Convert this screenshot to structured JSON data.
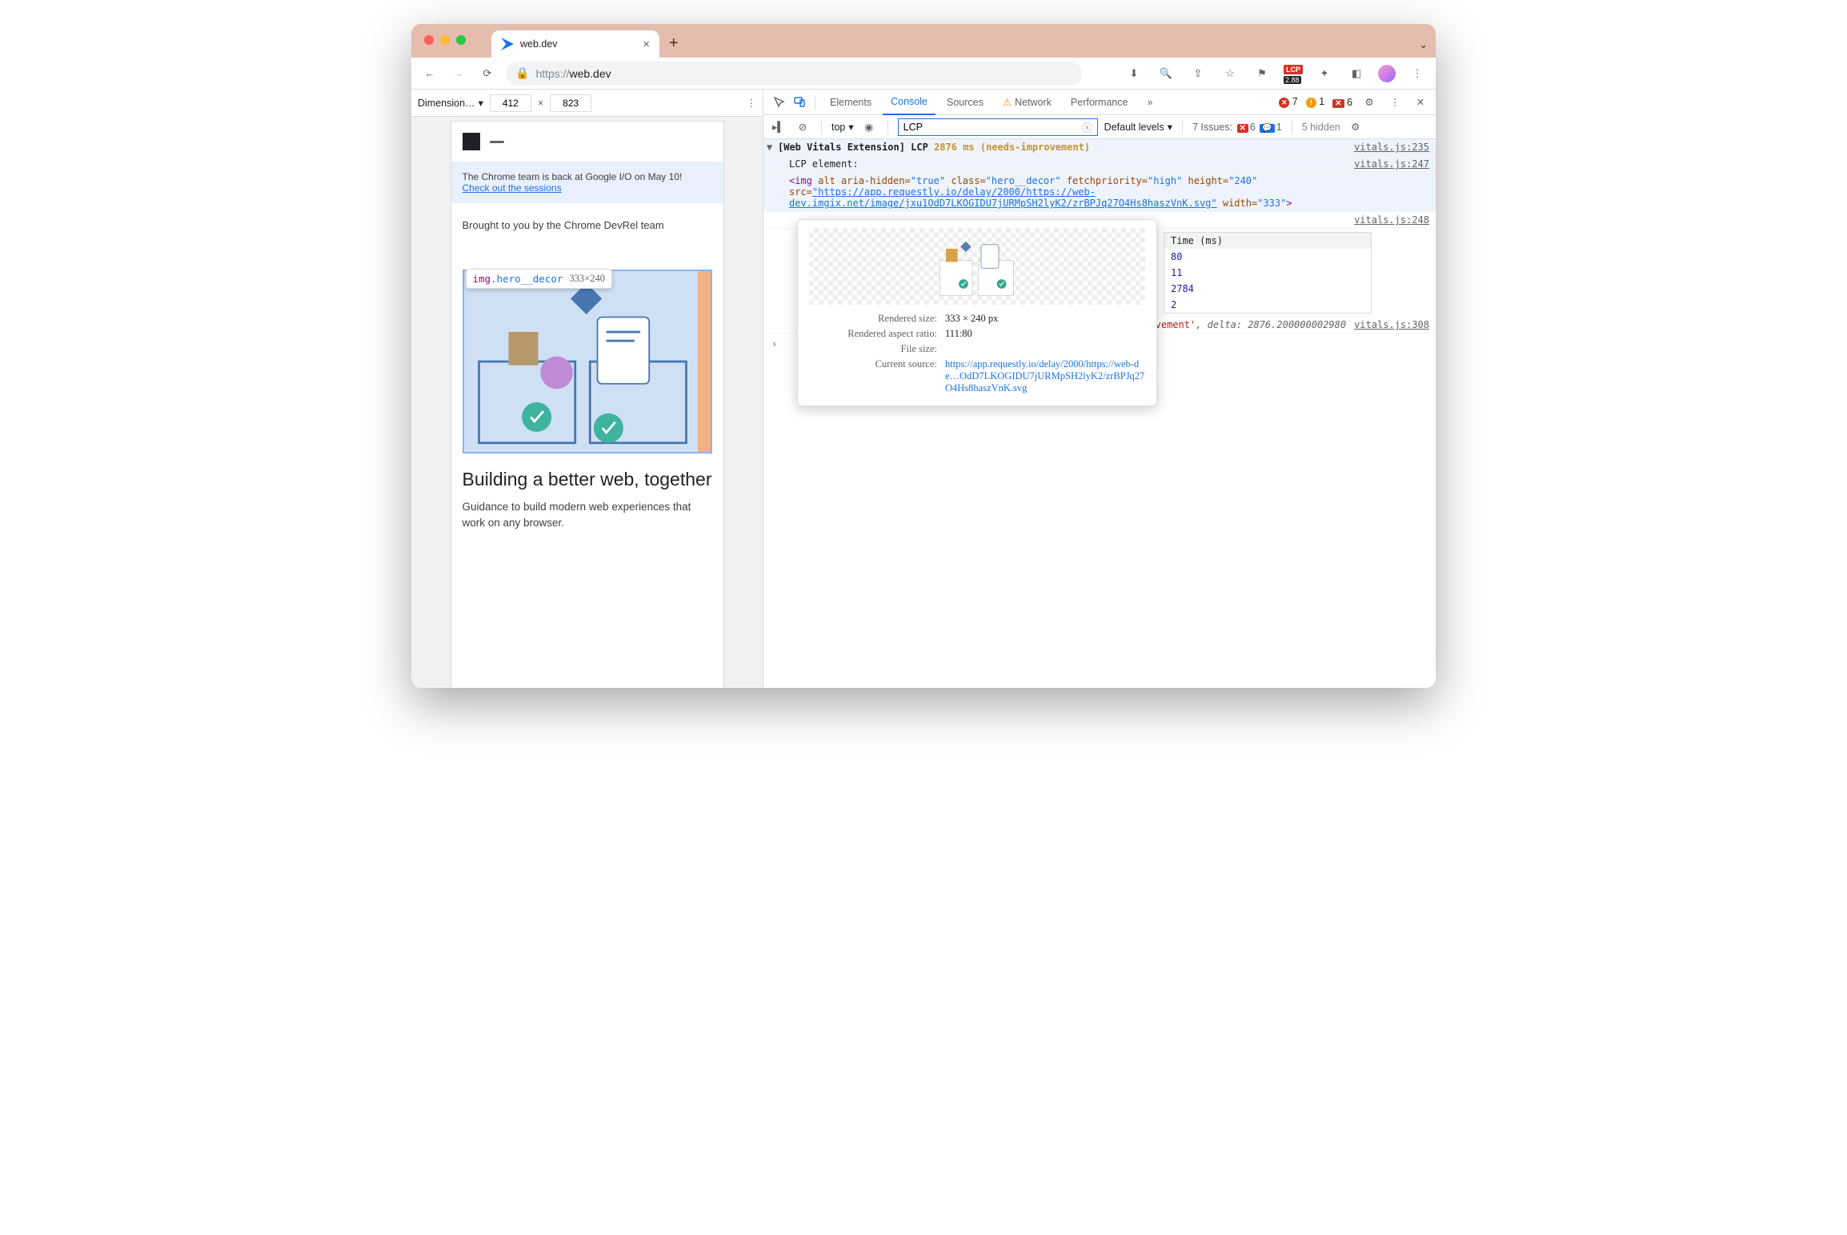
{
  "tab": {
    "title": "web.dev"
  },
  "toolbar": {
    "url_proto": "https://",
    "url_host": "web.dev",
    "ext_lcp_label": "LCP",
    "ext_lcp_value": "2.88"
  },
  "device_bar": {
    "label": "Dimension…",
    "width": "412",
    "height": "823",
    "sep": "×"
  },
  "page": {
    "banner_text": "The Chrome team is back at Google I/O on May 10! ",
    "banner_link": "Check out the sessions",
    "brought": "Brought to you by the Chrome DevRel team",
    "hover_sel": "img",
    "hover_class": ".hero__decor",
    "hover_dims": "333×240",
    "headline": "Building a better web, together",
    "sub": "Guidance to build modern web experiences that work on any browser."
  },
  "devtools": {
    "tabs": [
      "Elements",
      "Console",
      "Sources",
      "Network",
      "Performance"
    ],
    "active_tab": "Console",
    "errors": "7",
    "warnings": "1",
    "blocked": "6",
    "context": "top",
    "filter_value": "LCP",
    "levels": "Default levels",
    "issues_label": "7 Issues:",
    "issues_err": "6",
    "issues_info": "1",
    "hidden": "5 hidden"
  },
  "console": {
    "r1_prefix": "[Web Vitals Extension] LCP ",
    "r1_ms": "2876 ms ",
    "r1_status": "(needs-improvement)",
    "r1_src": "vitals.js:235",
    "r2_text": "LCP element:",
    "r2_src": "vitals.js:247",
    "el_open": "<img ",
    "a_alt_k": "alt ",
    "a_hidden_k": "aria-hidden=",
    "a_hidden_v": "\"true\"",
    "a_class_k": " class=",
    "a_class_v": "\"hero__decor\"",
    "a_fetch_k": " fetchpriority=",
    "a_fetch_v": "\"high\"",
    "a_h_k": " height=",
    "a_h_v": "\"240\"",
    "a_src_k": " src=",
    "a_src_v": "\"https://app.requestly.io/delay/2000/https://web-dev.imgix.net/image/jxu1OdD7LKOGIDU7jURMpSH2lyK2/zrBPJq27O4Hs8haszVnK.svg\"",
    "a_w_k": " width=",
    "a_w_v": "\"333\"",
    "el_close": ">",
    "tbl_src": "vitals.js:248",
    "th_time": "Time (ms)",
    "t1": "80",
    "t2": "11",
    "t3": "2784",
    "t4": "2",
    "delta_src": "vitals.js:308",
    "delta_status": "'needs-improvement'",
    "delta_lab": ", delta: ",
    "delta_val": "2876.200000002980"
  },
  "pop": {
    "rs_l": "Rendered size:",
    "rs_v": "333 × 240 px",
    "ar_l": "Rendered aspect ratio:",
    "ar_v": "111:80",
    "fs_l": "File size:",
    "fs_v": "",
    "cs_l": "Current source:",
    "cs_v": "https://app.requestly.io/delay/2000/https://web-de…OdD7LKOGIDU7jURMpSH2lyK2/zrBPJq27O4Hs8haszVnK.svg"
  }
}
